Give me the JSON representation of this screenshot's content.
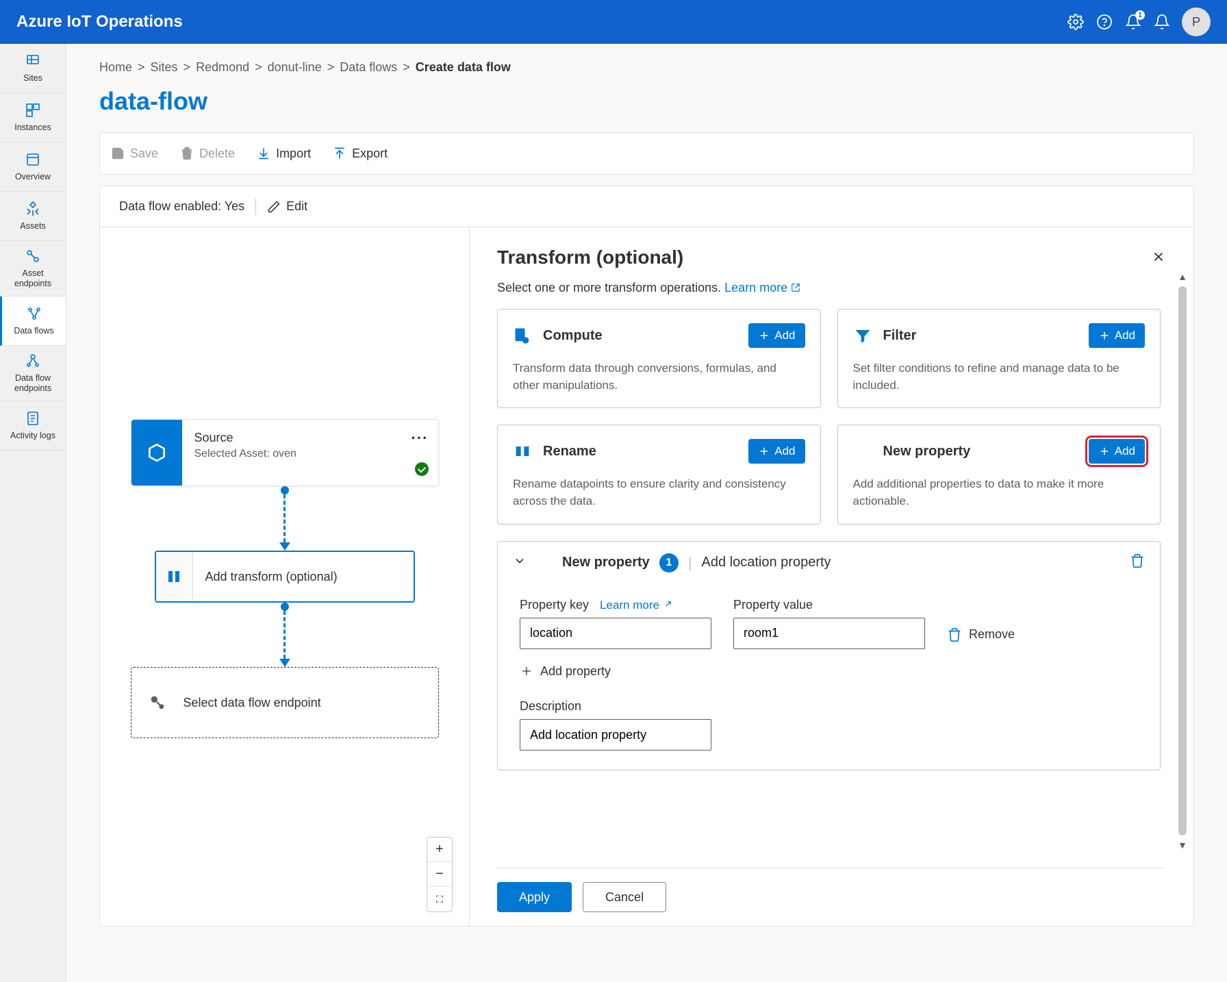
{
  "app": {
    "title": "Azure IoT Operations",
    "avatar_initial": "P",
    "alerts_badge": "1"
  },
  "sidebar": {
    "items": [
      {
        "label": "Sites"
      },
      {
        "label": "Instances"
      },
      {
        "label": "Overview"
      },
      {
        "label": "Assets"
      },
      {
        "label": "Asset endpoints"
      },
      {
        "label": "Data flows"
      },
      {
        "label": "Data flow endpoints"
      },
      {
        "label": "Activity logs"
      }
    ]
  },
  "breadcrumb": {
    "items": [
      "Home",
      "Sites",
      "Redmond",
      "donut-line",
      "Data flows"
    ],
    "current": "Create data flow"
  },
  "page": {
    "title": "data-flow"
  },
  "cmd": {
    "save": "Save",
    "delete": "Delete",
    "import": "Import",
    "export": "Export"
  },
  "canvas": {
    "enabled_label": "Data flow enabled: Yes",
    "edit": "Edit",
    "source_title": "Source",
    "source_sub": "Selected Asset: oven",
    "transform_label": "Add transform (optional)",
    "endpoint_label": "Select data flow endpoint"
  },
  "panel": {
    "title": "Transform (optional)",
    "desc_prefix": "Select one or more transform operations. ",
    "learn_more": "Learn more",
    "ops": {
      "compute": {
        "title": "Compute",
        "add": "Add",
        "desc": "Transform data through conversions, formulas, and other manipulations."
      },
      "filter": {
        "title": "Filter",
        "add": "Add",
        "desc": "Set filter conditions to refine and manage data to be included."
      },
      "rename": {
        "title": "Rename",
        "add": "Add",
        "desc": "Rename datapoints to ensure clarity and consistency across the data."
      },
      "newprop": {
        "title": "New property",
        "add": "Add",
        "desc": "Add additional properties to data to make it more actionable."
      }
    },
    "np": {
      "title": "New property",
      "count": "1",
      "sub": "Add location property",
      "key_label": "Property key",
      "learn": "Learn more",
      "value_label": "Property value",
      "remove": "Remove",
      "key_value": "location",
      "value_value": "room1",
      "addprop": "Add property",
      "desc_label": "Description",
      "desc_value": "Add location property"
    },
    "apply": "Apply",
    "cancel": "Cancel"
  }
}
